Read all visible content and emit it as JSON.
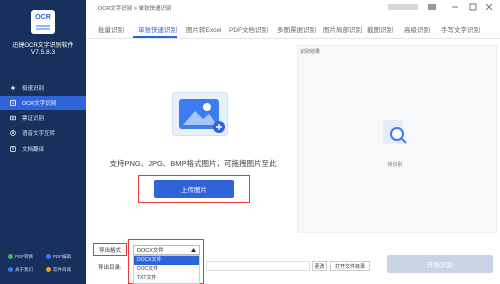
{
  "sidebar": {
    "logo_text": "OCR",
    "app_name": "迅捷OCR文字识别软件",
    "version": "V7.5.8.3",
    "items": [
      {
        "label": "极速识别",
        "icon": "bolt-icon"
      },
      {
        "label": "OCR文字识别",
        "icon": "ocr-icon",
        "active": true
      },
      {
        "label": "票证识别",
        "icon": "ticket-icon"
      },
      {
        "label": "语音文字互转",
        "icon": "microphone-icon"
      },
      {
        "label": "文档翻译",
        "icon": "translate-icon"
      }
    ],
    "footer": {
      "pdf_convert": "PDF转换",
      "pdf_edit": "PDF编辑",
      "about": "关于我们",
      "store": "软件商城"
    }
  },
  "header": {
    "breadcrumb": [
      "OCR文字识别",
      ">",
      "单张快速识别"
    ]
  },
  "tabs": [
    {
      "label": "批量识别"
    },
    {
      "label": "单张快速识别",
      "active": true
    },
    {
      "label": "图片转Excel"
    },
    {
      "label": "PDF文档识别"
    },
    {
      "label": "多图票据识别"
    },
    {
      "label": "图片局部识别"
    },
    {
      "label": "截图识别"
    },
    {
      "label": "高级识别"
    },
    {
      "label": "手写文字识别"
    }
  ],
  "upload": {
    "hint": "支持PNG、JPG、BMP格式图片，可拖拽图片至此",
    "button_label": "上传图片"
  },
  "result": {
    "title": "识别结果",
    "empty_text": "待识别"
  },
  "bottom": {
    "export_label": "导出格式",
    "output_dir_label": "导出目录:",
    "format_selected": "DOCX文件",
    "format_options": [
      "DOCX文件",
      "DOC文件",
      "TXT文件"
    ],
    "change_button": "更改",
    "open_dir_button": "打开文件目录",
    "start_button": "开始识别"
  },
  "colors": {
    "sidebar_bg": "#17305e",
    "accent": "#2f64d8",
    "highlight_outline": "#e53935",
    "disabled_button": "#c9d3e6"
  }
}
